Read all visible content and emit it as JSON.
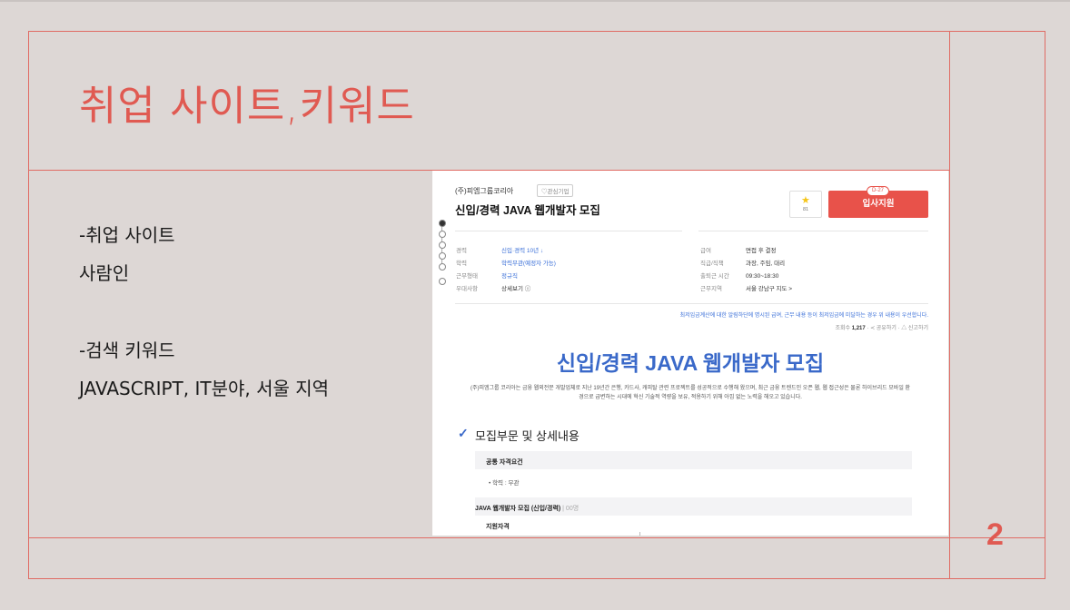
{
  "slide": {
    "title": "취업 사이트,키워드",
    "lines": [
      "-취업 사이트",
      "사람인",
      "-검색 키워드",
      "JAVASCRIPT, IT분야, 서울 지역"
    ],
    "page_number": "2",
    "accent_color": "#e05a52"
  },
  "posting": {
    "company": "(주)피엠그룹코리아",
    "interest_label": "♡관심기업",
    "title": "신입/경력 JAVA 웹개발자 모집",
    "star_count": "81",
    "apply_button": "입사지원",
    "dday": "D-27",
    "left_info": [
      {
        "label": "경력",
        "value": "신입·경력 10년 ↓",
        "link": true
      },
      {
        "label": "학력",
        "value": "학력무관(예정자 가능)",
        "link": true
      },
      {
        "label": "근무형태",
        "value": "정규직",
        "link": true
      },
      {
        "label": "우대사항",
        "value": "상세보기 ⓘ",
        "link": false
      }
    ],
    "right_info": [
      {
        "label": "급여",
        "value": "면접 후 결정"
      },
      {
        "label": "직급/직책",
        "value": "과장, 주임, 대리"
      },
      {
        "label": "출퇴근 시간",
        "value": "09:30~18:30"
      },
      {
        "label": "근무지역",
        "value": "서울 강남구  지도 >"
      }
    ],
    "notice": "최저임금계산에 대한 알림하단에 명시된 급여, 근무 내용 등이 최저임금에 미달하는 경우 위 내용이 우선합니다.",
    "views_label": "조회수",
    "views": "1,217",
    "share": "공유하기",
    "report": "신고하기",
    "big_title": "신입/경력 JAVA 웹개발자 모집",
    "intro": "(주)피엠그룹 코리아는 금융 웹외전문 개발업체로 지난 19년간 은행, 카드사, 캐피탈 관련 프로젝트를 성공적으로 수행해 왔으며, 최근 금융 트렌드인 오픈 웹, 웹 접근성은 물론 하이브리드 모바일 환경으로 급변하는 시대에 혁신 기술적 역량을 보유, 적용하기 위해 아낌 없는 노력을 해오고 있습니다.",
    "section_title": "모집부문 및 상세내용",
    "common_req_title": "공통 자격요건",
    "common_req_item": "• 학력 : 무관",
    "job_title": "JAVA 웹개발자 모집 (신입/경력)",
    "job_count": "| 00명",
    "qual_title": "지원자격"
  }
}
